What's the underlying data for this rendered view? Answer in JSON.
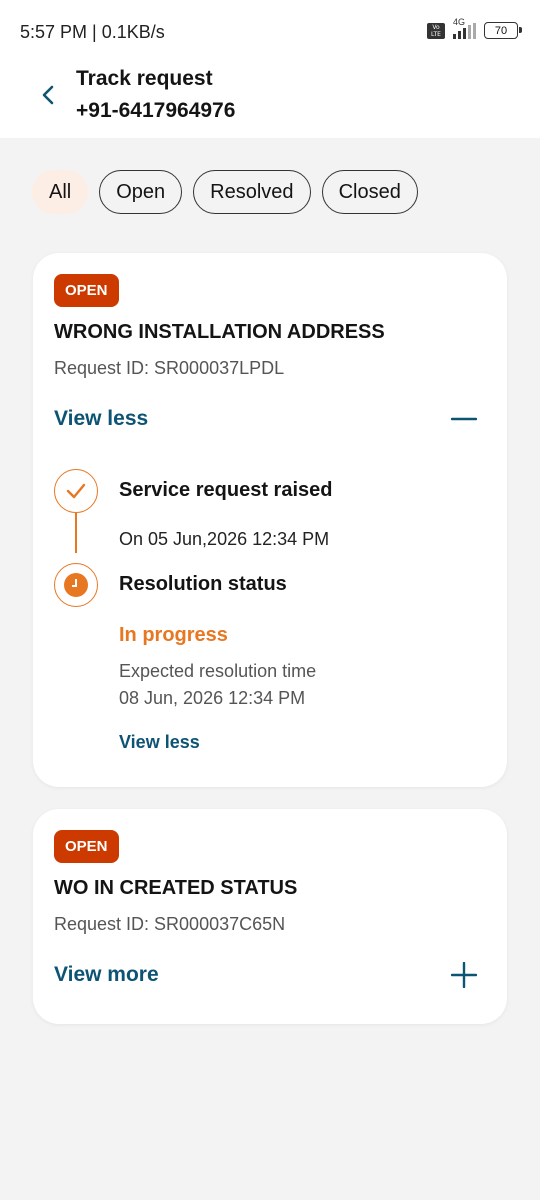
{
  "status_bar": {
    "time": "5:57 PM | 0.1KB/s",
    "volte": "Vo LTE",
    "network": "4G",
    "battery": "70"
  },
  "header": {
    "title": "Track request",
    "subtitle": "+91-6417964976",
    "back_icon": "chevron-left-icon"
  },
  "filters": [
    {
      "label": "All",
      "active": true
    },
    {
      "label": "Open",
      "active": false
    },
    {
      "label": "Resolved",
      "active": false
    },
    {
      "label": "Closed",
      "active": false
    }
  ],
  "requests": [
    {
      "status": "OPEN",
      "title": "WRONG INSTALLATION ADDRESS",
      "request_id": "Request ID: SR000037LPDL",
      "toggle_label": "View less",
      "toggle_icon": "minus-icon",
      "timeline": {
        "step1_title": "Service request raised",
        "step1_date": "On 05 Jun,2026 12:34 PM",
        "step2_title": "Resolution status",
        "step2_status": "In progress",
        "expected_label": "Expected resolution time",
        "expected_time": "08 Jun, 2026 12:34 PM",
        "link": "View less"
      }
    },
    {
      "status": "OPEN",
      "title": "WO IN CREATED STATUS",
      "request_id": "Request ID: SR000037C65N",
      "toggle_label": "View more",
      "toggle_icon": "plus-icon"
    }
  ],
  "colors": {
    "accent": "#e87722",
    "link": "#0d5474",
    "badge": "#cc3a00",
    "chip_active": "#fdeee5"
  }
}
